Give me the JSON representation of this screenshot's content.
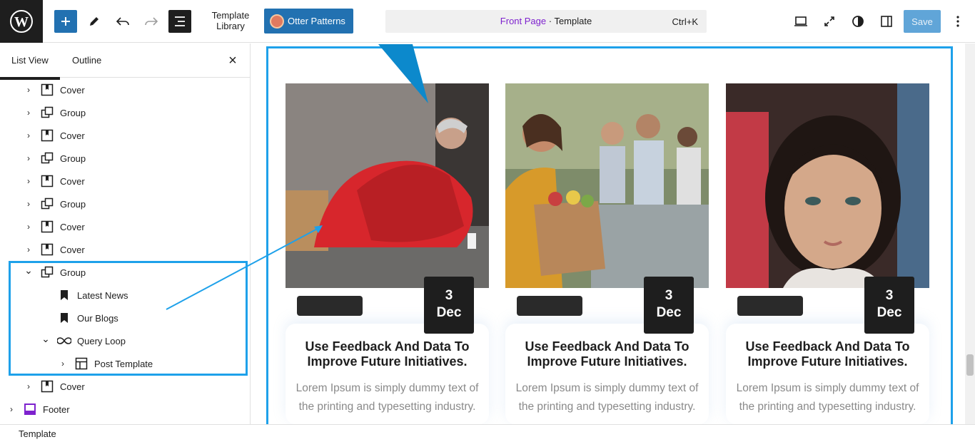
{
  "topbar": {
    "template_library_line1": "Template",
    "template_library_line2": "Library",
    "otter_patterns_label": "Otter Patterns",
    "command_page": "Front Page",
    "command_sep": " · Template",
    "command_shortcut": "Ctrl+K",
    "save_label": "Save"
  },
  "sidebar": {
    "tabs": [
      "List View",
      "Outline"
    ],
    "items": [
      {
        "label": "Cover",
        "icon": "cover-icon"
      },
      {
        "label": "Group",
        "icon": "group-icon"
      },
      {
        "label": "Cover",
        "icon": "cover-icon"
      },
      {
        "label": "Group",
        "icon": "group-icon"
      },
      {
        "label": "Cover",
        "icon": "cover-icon"
      },
      {
        "label": "Group",
        "icon": "group-icon"
      },
      {
        "label": "Cover",
        "icon": "cover-icon"
      },
      {
        "label": "Cover",
        "icon": "cover-icon"
      },
      {
        "label": "Group",
        "icon": "group-icon",
        "expanded": true
      },
      {
        "label": "Latest News",
        "icon": "bookmark-icon"
      },
      {
        "label": "Our Blogs",
        "icon": "bookmark-icon"
      },
      {
        "label": "Query Loop",
        "icon": "loop-icon",
        "expanded": true
      },
      {
        "label": "Post Template",
        "icon": "layout-icon"
      },
      {
        "label": "Cover",
        "icon": "cover-icon"
      },
      {
        "label": "Footer",
        "icon": "footer-icon"
      }
    ]
  },
  "status_bar": {
    "label": "Template"
  },
  "cards": [
    {
      "day": "3",
      "month": "Dec",
      "title": "Use Feedback And Data To Improve Future Initiatives.",
      "text": "Lorem Ipsum is simply dummy text of the printing and typesetting industry."
    },
    {
      "day": "3",
      "month": "Dec",
      "title": "Use Feedback And Data To Improve Future Initiatives.",
      "text": "Lorem Ipsum is simply dummy text of the printing and typesetting industry."
    },
    {
      "day": "3",
      "month": "Dec",
      "title": "Use Feedback And Data To Improve Future Initiatives.",
      "text": "Lorem Ipsum is simply dummy text of the printing and typesetting industry."
    }
  ],
  "colors": {
    "accent": "#2271b1",
    "highlight": "#1ea1ea",
    "command_page": "#7e22ce",
    "save_disabled": "#60a5d8"
  }
}
